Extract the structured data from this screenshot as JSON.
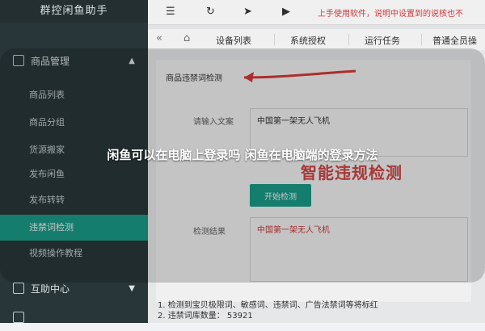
{
  "sidebar": {
    "brand": "群控闲鱼助手",
    "top_item": "",
    "sections": [
      {
        "label": "商品管理",
        "expanded": true
      },
      {
        "label": "互助中心",
        "expanded": false
      },
      {
        "label": "",
        "expanded": false
      }
    ],
    "sub_items": [
      {
        "label": "商品列表",
        "active": false
      },
      {
        "label": "商品分组",
        "active": false
      },
      {
        "label": "货源搬家",
        "active": false
      },
      {
        "label": "发布闲鱼",
        "active": false
      },
      {
        "label": "发布转转",
        "active": false
      },
      {
        "label": "违禁词检测",
        "active": true
      },
      {
        "label": "视频操作教程",
        "active": false
      }
    ]
  },
  "topbar": {
    "tip_text": "上手使用软件，说明中设置到的说核也不"
  },
  "tabs": {
    "items": [
      {
        "label": "设备列表"
      },
      {
        "label": "系统授权"
      },
      {
        "label": "运行任务"
      },
      {
        "label": "普通全员操"
      }
    ]
  },
  "panel": {
    "title": "商品违禁词检测",
    "input_label": "请输入文案",
    "input_value": "中国第一架无人飞机",
    "button_label": "开始检测",
    "result_label": "检测结果",
    "result_value": "中国第一架无人飞机"
  },
  "footnotes": [
    "1. 检测到宝贝极限词、敏感词、违禁词、广告法禁词等将标红",
    "2. 违禁词库数量： 53921"
  ],
  "annotation_text": "智能违规检测",
  "headline": "闲鱼可以在电脑上登录吗 闲鱼在电脑端的登录方法",
  "colors": {
    "accent": "#1ba38f",
    "sidebar_bg": "#2b3a3d",
    "warning": "#e23b3b"
  }
}
